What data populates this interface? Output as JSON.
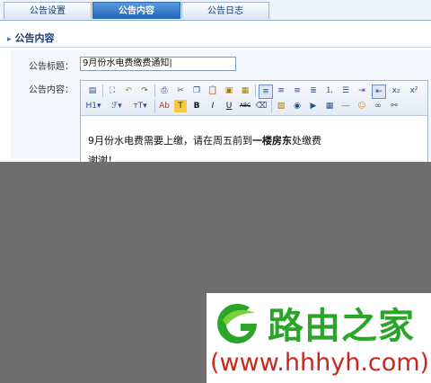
{
  "tabs": [
    {
      "label": "公告设置",
      "active": false
    },
    {
      "label": "公告内容",
      "active": true
    },
    {
      "label": "公告日志",
      "active": false
    }
  ],
  "section": {
    "title": "公告内容"
  },
  "form": {
    "title_label": "公告标题：",
    "title_value": "9月份水电费缴费通知|",
    "content_label": "公告内容："
  },
  "toolbar": {
    "heading": "H1",
    "font": "ℱ",
    "size": "тT",
    "bold": "B",
    "italic": "I",
    "underline": "U",
    "strike": "ABC",
    "subscript": "x₂",
    "superscript": "x²",
    "text_color": "Ab",
    "bg_color": "T"
  },
  "editor": {
    "line1_pre": "9月份水电费需要上缴，请在周五前到",
    "line1_bold": "一楼房东",
    "line1_post": "处缴费",
    "line2": "谢谢！"
  },
  "watermark": {
    "cn": "路由之家",
    "url": "(www.hhhyh.com)"
  },
  "colors": {
    "accent": "#1e63b8",
    "overlay": "#6e6e6e",
    "brand_green": "#2aa52a",
    "brand_red": "#c7281e"
  }
}
